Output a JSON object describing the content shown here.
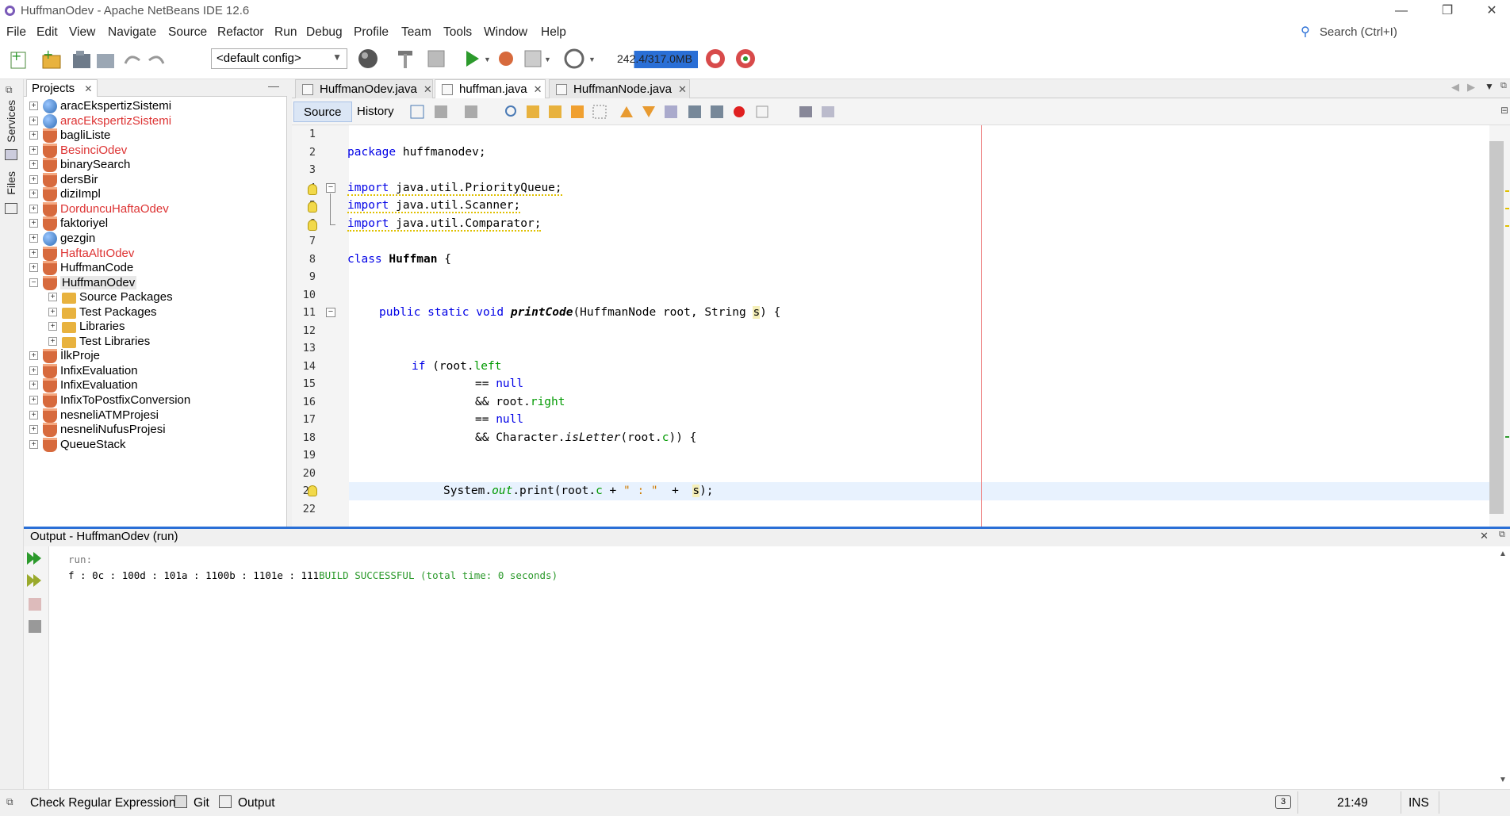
{
  "window": {
    "title": "HuffmanOdev - Apache NetBeans IDE 12.6",
    "minimize": "—",
    "restore": "❐",
    "close": "✕"
  },
  "menu": [
    "File",
    "Edit",
    "View",
    "Navigate",
    "Source",
    "Refactor",
    "Run",
    "Debug",
    "Profile",
    "Team",
    "Tools",
    "Window",
    "Help"
  ],
  "search": {
    "placeholder": "Search (Ctrl+I)"
  },
  "toolbar": {
    "config": "<default config>",
    "memory": "242.4/317.0MB",
    "memory_used_fraction": 0.76
  },
  "side_tabs": {
    "services": "Services",
    "files": "Files"
  },
  "projects": {
    "tab_label": "Projects",
    "items": [
      {
        "label": "aracEkspertizSistemi",
        "icon": "globe-icon",
        "error": false,
        "level": 0,
        "expanded": false
      },
      {
        "label": "aracEkspertizSistemi",
        "icon": "globe-icon",
        "error": true,
        "level": 0,
        "expanded": false
      },
      {
        "label": "bagliListe",
        "icon": "java-cup-icon",
        "error": false,
        "level": 0,
        "expanded": false
      },
      {
        "label": "BesinciOdev",
        "icon": "java-cup-icon",
        "error": true,
        "level": 0,
        "expanded": false
      },
      {
        "label": "binarySearch",
        "icon": "java-cup-icon",
        "error": false,
        "level": 0,
        "expanded": false
      },
      {
        "label": "dersBir",
        "icon": "java-cup-icon",
        "error": false,
        "level": 0,
        "expanded": false
      },
      {
        "label": "diziImpl",
        "icon": "java-cup-icon",
        "error": false,
        "level": 0,
        "expanded": false
      },
      {
        "label": "DorduncuHaftaOdev",
        "icon": "java-cup-icon",
        "error": true,
        "level": 0,
        "expanded": false
      },
      {
        "label": "faktoriyel",
        "icon": "java-cup-icon",
        "error": false,
        "level": 0,
        "expanded": false
      },
      {
        "label": "gezgin",
        "icon": "globe-icon",
        "error": false,
        "level": 0,
        "expanded": false
      },
      {
        "label": "HaftaAltıOdev",
        "icon": "java-cup-icon",
        "error": true,
        "level": 0,
        "expanded": false
      },
      {
        "label": "HuffmanCode",
        "icon": "java-cup-icon",
        "error": false,
        "level": 0,
        "expanded": false
      },
      {
        "label": "HuffmanOdev",
        "icon": "java-cup-icon",
        "error": false,
        "level": 0,
        "expanded": true
      },
      {
        "label": "Source Packages",
        "icon": "folder-icon",
        "error": false,
        "level": 1,
        "expanded": false
      },
      {
        "label": "Test Packages",
        "icon": "folder-icon",
        "error": false,
        "level": 1,
        "expanded": false
      },
      {
        "label": "Libraries",
        "icon": "folder-icon",
        "error": false,
        "level": 1,
        "expanded": false
      },
      {
        "label": "Test Libraries",
        "icon": "folder-icon",
        "error": false,
        "level": 1,
        "expanded": false
      },
      {
        "label": "İlkProje",
        "icon": "java-cup-icon",
        "error": false,
        "level": 0,
        "expanded": false
      },
      {
        "label": "InfixEvaluation",
        "icon": "java-cup-icon",
        "error": false,
        "level": 0,
        "expanded": false
      },
      {
        "label": "InfixEvaluation",
        "icon": "java-cup-icon",
        "error": false,
        "level": 0,
        "expanded": false
      },
      {
        "label": "InfixToPostfixConversion",
        "icon": "java-cup-icon",
        "error": false,
        "level": 0,
        "expanded": false
      },
      {
        "label": "nesneliATMProjesi",
        "icon": "java-cup-icon",
        "error": false,
        "level": 0,
        "expanded": false
      },
      {
        "label": "nesneliNufusProjesi",
        "icon": "java-cup-icon",
        "error": false,
        "level": 0,
        "expanded": false
      },
      {
        "label": "QueueStack",
        "icon": "java-cup-icon",
        "error": false,
        "level": 0,
        "expanded": false
      }
    ]
  },
  "editor": {
    "tabs": [
      {
        "label": "HuffmanOdev.java",
        "active": false
      },
      {
        "label": "huffman.java",
        "active": true
      },
      {
        "label": "HuffmanNode.java",
        "active": false
      }
    ],
    "source_label": "Source",
    "history_label": "History",
    "line_numbers": [
      "1",
      "2",
      "3",
      "4",
      "5",
      "6",
      "7",
      "8",
      "9",
      "10",
      "11",
      "12",
      "13",
      "14",
      "15",
      "16",
      "17",
      "18",
      "19",
      "20",
      "21",
      "22"
    ],
    "code": {
      "l2_kw": "package",
      "l2_rest": " huffmanodev;",
      "l4_kw": "import",
      "l4_rest": " java.util.PriorityQueue;",
      "l5_kw": "import",
      "l5_rest": " java.util.Scanner;",
      "l6_kw": "import",
      "l6_rest": " java.util.Comparator;",
      "l8_kw": "class",
      "l8_name": "Huffman",
      "l8_rest": " {",
      "l11_kw": "public static void",
      "l11_method": "printCode",
      "l11_a": "(HuffmanNode root, String ",
      "l11_param": "s",
      "l11_b": ") {",
      "l14_kw": "if",
      "l14_a": " (root.",
      "l14_fld": "left",
      "l15_a": "== ",
      "l15_kw": "null",
      "l16_a": "&& root.",
      "l16_fld": "right",
      "l17_a": "== ",
      "l17_kw": "null",
      "l18_a": "&& Character.",
      "l18_method": "isLetter",
      "l18_b": "(root.",
      "l18_fld": "c",
      "l18_c": ")) {",
      "l21_a": "System.",
      "l21_fld": "out",
      "l21_b": ".print(root.",
      "l21_fld2": "c",
      "l21_c": " + ",
      "l21_str": "\" : \"",
      "l21_d": "  +  ",
      "l21_param": "s",
      "l21_e": ");"
    }
  },
  "output": {
    "title": "Output - HuffmanOdev (run)",
    "line1": "run:",
    "line2_result": "f : 0c : 100d : 101a : 1100b : 1101e : 111",
    "line2_build": "BUILD SUCCESSFUL (total time: 0 seconds)"
  },
  "statusbar": {
    "check_regex": "Check Regular Expression",
    "git": "Git",
    "output": "Output",
    "notifications": "3",
    "position": "21:49",
    "mode": "INS"
  }
}
